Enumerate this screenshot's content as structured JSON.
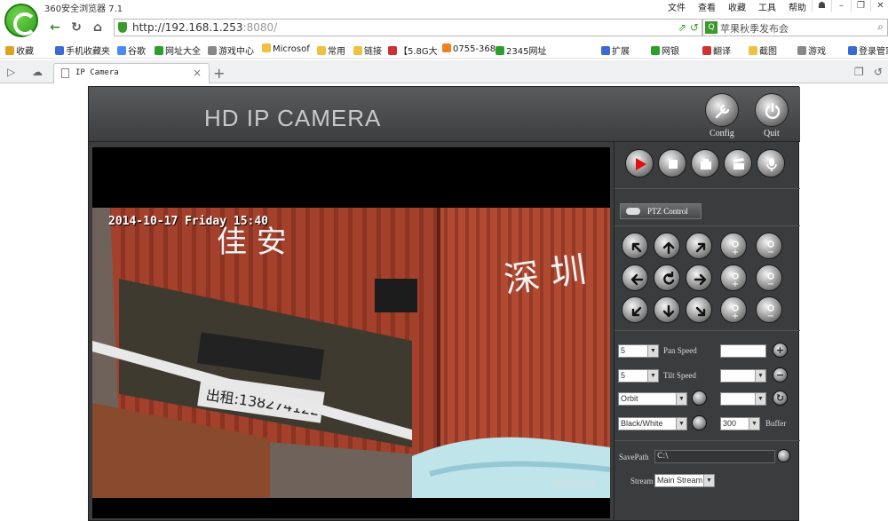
{
  "browser": {
    "title": "360安全浏览器 7.1",
    "menu": [
      "文件",
      "查看",
      "收藏",
      "工具",
      "帮助"
    ],
    "url_host": "http://192.168.1.253",
    "url_port": ":8080/",
    "search_text": "苹果秋季发布会",
    "bookmarks": [
      {
        "label": "收藏",
        "color": "#e0a020"
      },
      {
        "label": "手机收藏夹",
        "color": "#3a6ad4"
      },
      {
        "label": "谷歌",
        "color": "#4a8af4"
      },
      {
        "label": "网址大全",
        "color": "#2aa02a"
      },
      {
        "label": "游戏中心",
        "color": "#888888"
      },
      {
        "label": "Microsof",
        "color": "#f0c040"
      },
      {
        "label": "常用",
        "color": "#f0c040"
      },
      {
        "label": "链接",
        "color": "#f0c040"
      },
      {
        "label": "【5.8G大",
        "color": "#d03030"
      },
      {
        "label": "0755-368",
        "color": "#f08020"
      },
      {
        "label": "2345网址",
        "color": "#2aa02a"
      }
    ],
    "bookmarks_right": [
      {
        "label": "扩展",
        "color": "#3a6ad4"
      },
      {
        "label": "网银",
        "color": "#2aa02a"
      },
      {
        "label": "翻译",
        "color": "#d03030"
      },
      {
        "label": "截图",
        "color": "#f0c040"
      },
      {
        "label": "游戏",
        "color": "#888888"
      },
      {
        "label": "登录管家",
        "color": "#3a6ad4"
      }
    ],
    "tab_label": "IP Camera"
  },
  "app": {
    "title": "HD IP CAMERA",
    "config_label": "Config",
    "quit_label": "Quit",
    "osd_text": "2014-10-17 Friday 15:40",
    "watermark": "HotPeed",
    "ptz_label": "PTZ Control",
    "pan_speed_value": "5",
    "pan_speed_label": "Pan Speed",
    "tilt_speed_value": "5",
    "tilt_speed_label": "Tilt Speed",
    "orbit_value": "Orbit",
    "color_mode_value": "Black/White",
    "buffer_value": "300",
    "buffer_label": "Buffer",
    "savepath_label": "SavePath",
    "savepath_value": "C:\\",
    "stream_label": "Stream",
    "stream_value": "Main Stream"
  }
}
